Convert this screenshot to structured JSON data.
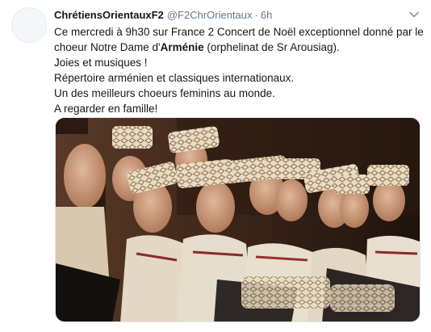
{
  "tweet": {
    "display_name": "ChrétiensOrientauxF2",
    "handle": "@F2ChrOrientaux",
    "separator": "·",
    "time": "6h",
    "text_lines": {
      "l1": "Ce mercredi à 9h30 sur France 2 Concert de Noël exceptionnel donné par le",
      "l2a": "choeur Notre Dame d'",
      "l2b": "Arménie",
      "l2c": " (orphelinat de Sr Arousiag).",
      "l3": "Joies et musiques !",
      "l4": "Répertoire arménien et classiques internationaux.",
      "l5": "Un des meilleurs choeurs feminins au monde.",
      "l6": "A regarder en famille!"
    },
    "icons": {
      "caret": "chevron-down-icon",
      "avatar": "avatar"
    },
    "colors": {
      "name": "#14171a",
      "secondary": "#657786",
      "media_bg": "#2a1a12"
    }
  }
}
